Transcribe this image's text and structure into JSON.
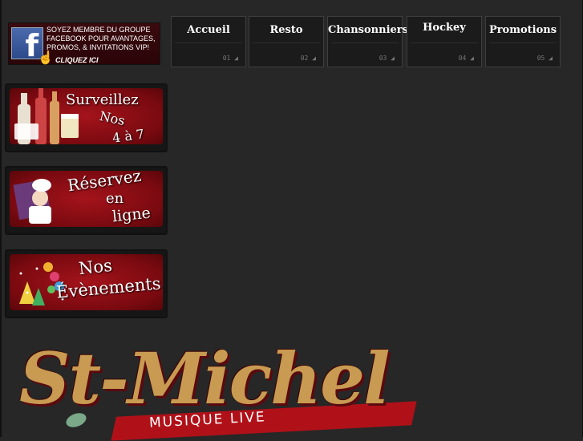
{
  "facebook": {
    "text": "SOYEZ MEMBRE DU GROUPE FACEBOOK POUR AVANTAGES, PROMOS, & INVITATIONS VIP!",
    "cta": "CLIQUEZ ICI",
    "logo_letter": "f"
  },
  "nav": [
    {
      "label": "Accueil",
      "num": "01 ◢"
    },
    {
      "label": "Resto",
      "num": "02 ◢"
    },
    {
      "label": "Chansonniers",
      "num": "03 ◢"
    },
    {
      "label": "Hockey",
      "num": "04 ◢"
    },
    {
      "label": "Promotions",
      "num": "05 ◢"
    }
  ],
  "promos": {
    "surveillez": {
      "line1": "Surveillez",
      "line2": "Nos",
      "line3": "4 à 7"
    },
    "reservez": {
      "line1": "Réservez",
      "line2": "en",
      "line3": "ligne"
    },
    "evenements": {
      "line1": "Nos",
      "line2": "Évènements"
    }
  },
  "logo": {
    "name": "St-Michel",
    "tagline": "MUSIQUE LIVE"
  }
}
